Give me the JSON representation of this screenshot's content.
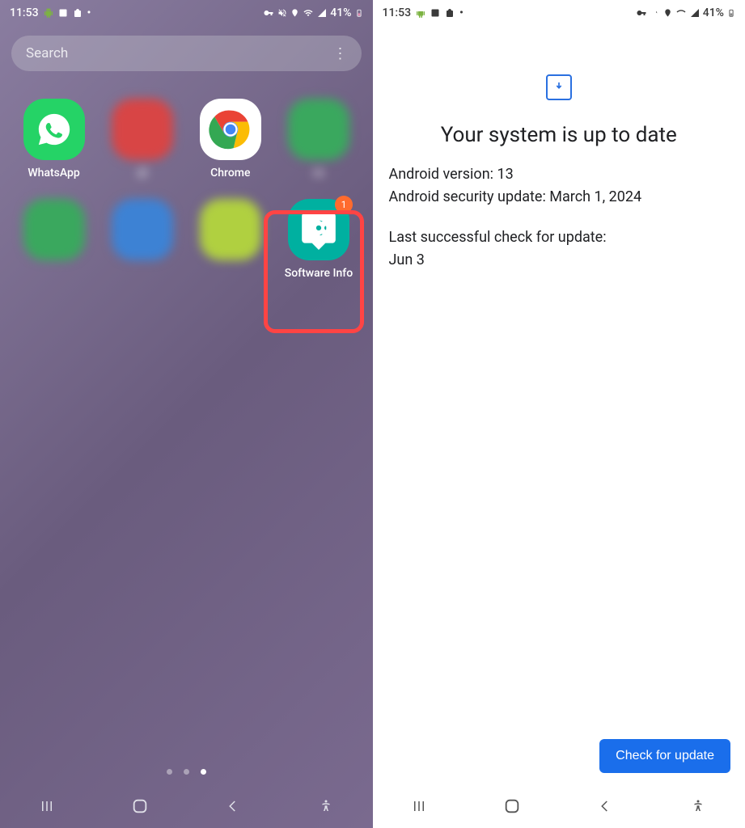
{
  "status": {
    "time": "11:53",
    "battery": "41%"
  },
  "search": {
    "placeholder": "Search"
  },
  "apps": {
    "whatsapp": "WhatsApp",
    "chrome": "Chrome",
    "blurred_label2": "al",
    "blurred_label4": "m",
    "software_info": "Software Info",
    "badge_count": "1"
  },
  "update": {
    "title": "Your system is up to date",
    "version_line": "Android version: 13",
    "security_line": "Android security update: March 1, 2024",
    "last_check_label": "Last successful check for update:",
    "last_check_date": "Jun 3",
    "button": "Check for update"
  }
}
